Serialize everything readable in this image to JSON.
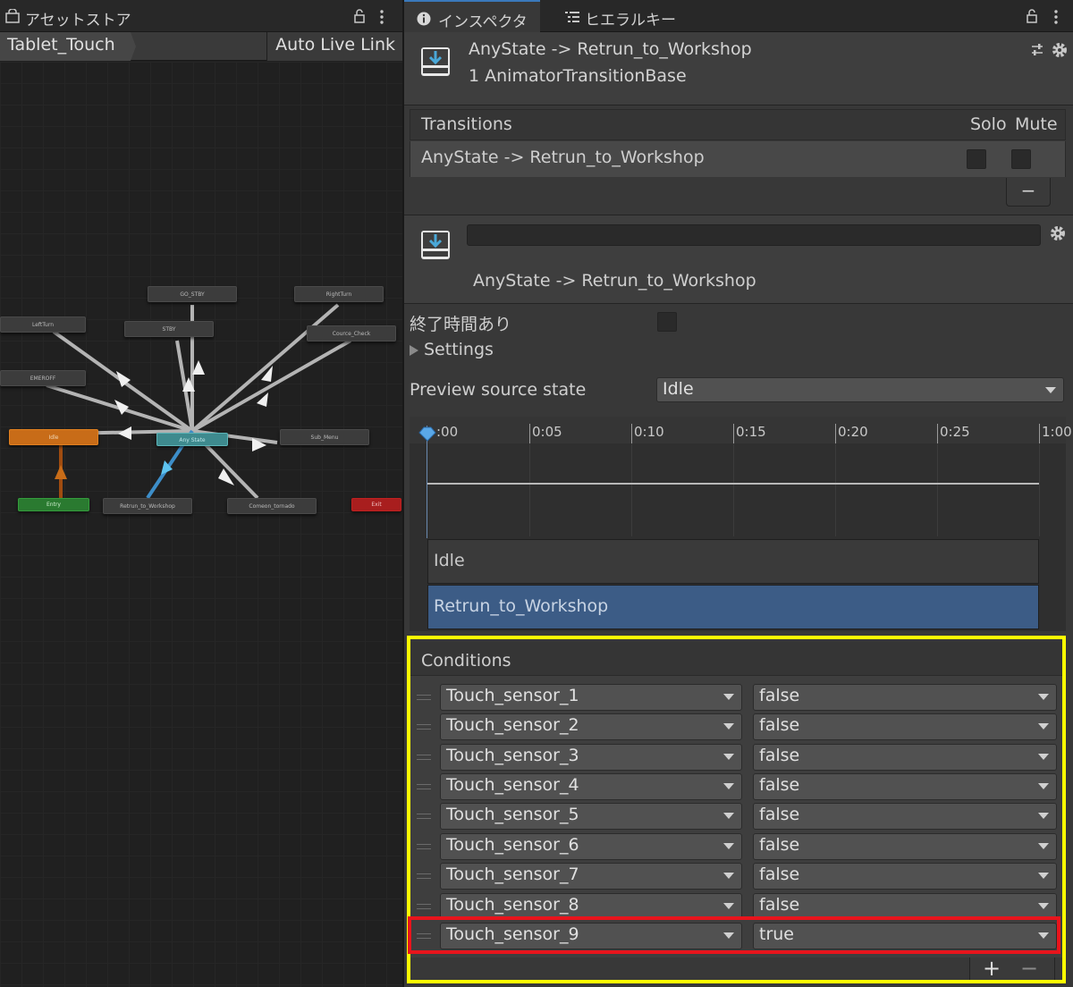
{
  "left_panel": {
    "tab_title": "アセットストア",
    "breadcrumb": "Tablet_Touch",
    "auto_live_link": "Auto Live Link",
    "nodes": {
      "go_stby": "GO_STBY",
      "right_turn": "RightTurn",
      "left_turn": "LeftTurn",
      "stby": "STBY",
      "cource_check": "Cource_Check",
      "emeroff": "EMEROFF",
      "idle": "Idle",
      "any_state": "Any State",
      "sub_menu": "Sub_Menu",
      "entry": "Entry",
      "retrun_to_workshop": "Retrun_to_Workshop",
      "comeon_tornado": "Comeon_tornado",
      "exit": "Exit"
    }
  },
  "right_panel": {
    "tabs": [
      {
        "label": "インスペクター",
        "icon": "info-icon"
      },
      {
        "label": "ヒエラルキー",
        "icon": "list-icon"
      }
    ],
    "header": {
      "title": "AnyState -> Retrun_to_Workshop",
      "subtitle": "1 AnimatorTransitionBase"
    },
    "transitions": {
      "header_label": "Transitions",
      "solo_label": "Solo",
      "mute_label": "Mute",
      "row_label": "AnyState -> Retrun_to_Workshop",
      "remove_label": "−"
    },
    "transition_detail": {
      "name_value": "",
      "label": "AnyState -> Retrun_to_Workshop"
    },
    "settings": {
      "has_exit_time_label": "終了時間あり",
      "settings_label": "Settings",
      "preview_label": "Preview source state",
      "preview_value": "Idle"
    },
    "timeline": {
      "ticks": [
        ":00",
        "0:05",
        "0:10",
        "0:15",
        "0:20",
        "0:25",
        "1:00"
      ],
      "source_state": "Idle",
      "dest_state": "Retrun_to_Workshop"
    },
    "conditions": {
      "header_label": "Conditions",
      "rows": [
        {
          "param": "Touch_sensor_1",
          "value": "false"
        },
        {
          "param": "Touch_sensor_2",
          "value": "false"
        },
        {
          "param": "Touch_sensor_3",
          "value": "false"
        },
        {
          "param": "Touch_sensor_4",
          "value": "false"
        },
        {
          "param": "Touch_sensor_5",
          "value": "false"
        },
        {
          "param": "Touch_sensor_6",
          "value": "false"
        },
        {
          "param": "Touch_sensor_7",
          "value": "false"
        },
        {
          "param": "Touch_sensor_8",
          "value": "false"
        },
        {
          "param": "Touch_sensor_9",
          "value": "true"
        }
      ],
      "add_label": "+",
      "remove_label": "−"
    }
  },
  "colors": {
    "highlight_yellow": "#ffff00",
    "highlight_red": "#e8141c",
    "accent_blue": "#3a79bb",
    "idle_orange": "#c86c18",
    "entry_green": "#2a7a30",
    "exit_red": "#a81e1e"
  }
}
